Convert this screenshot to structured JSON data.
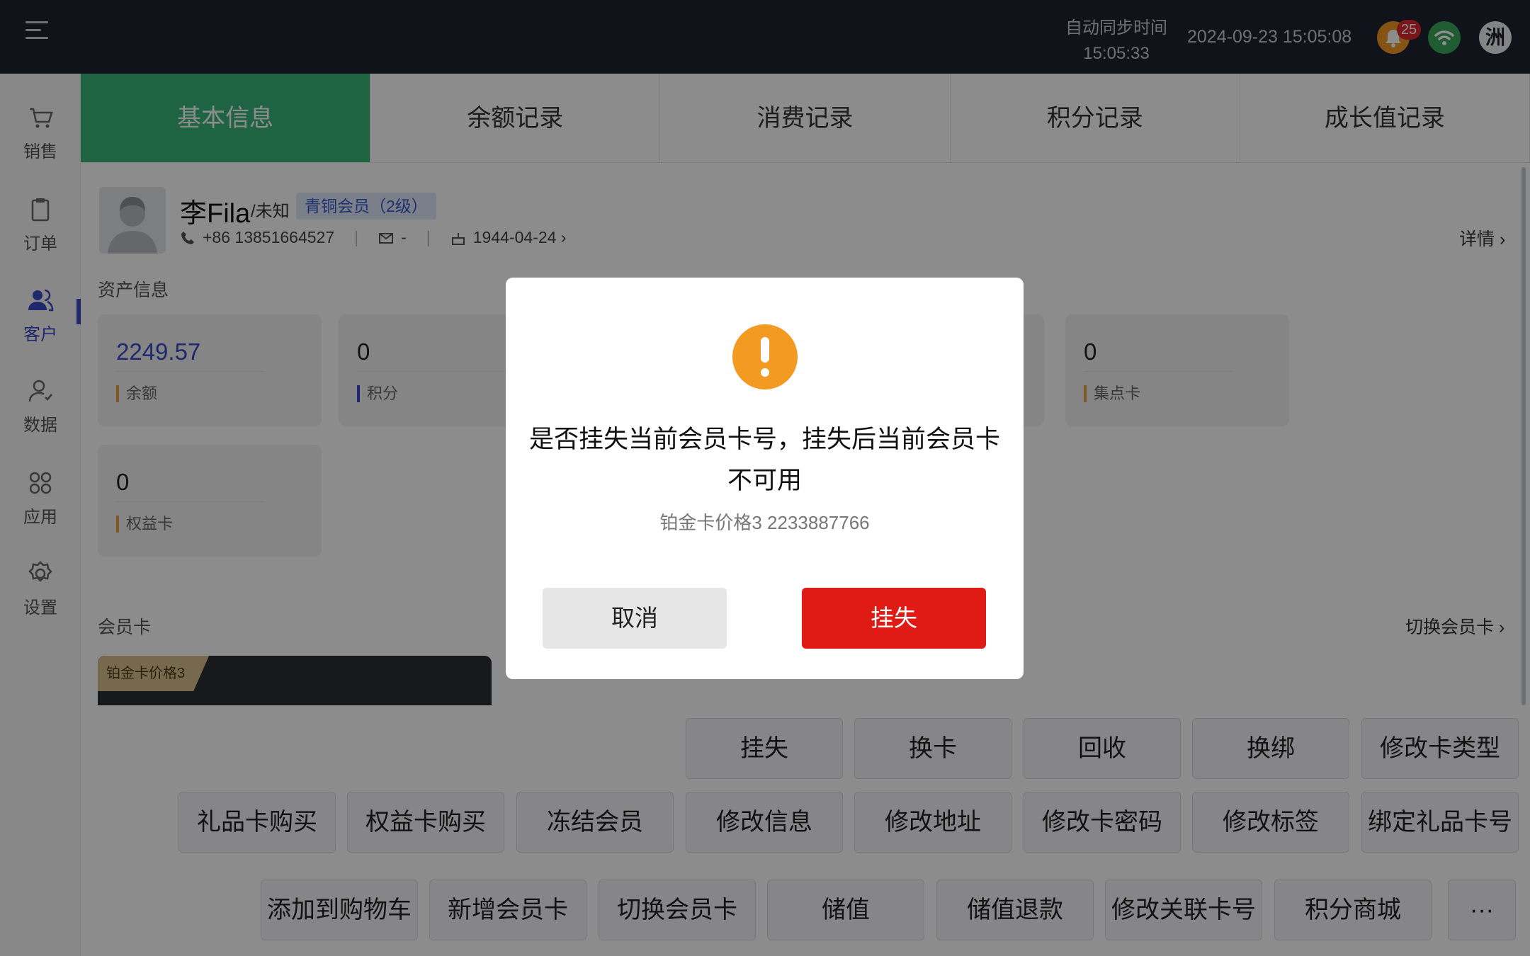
{
  "topbar": {
    "sync_label": "自动同步时间",
    "sync_time": "15:05:33",
    "datetime": "2024-09-23 15:05:08",
    "notification_count": "25",
    "avatar_char": "洲",
    "icons": [
      "menu-icon",
      "bell-icon",
      "wifi-icon",
      "avatar"
    ]
  },
  "sidebar": {
    "items": [
      {
        "label": "销售",
        "icon": "cart-icon"
      },
      {
        "label": "订单",
        "icon": "clipboard-icon"
      },
      {
        "label": "客户",
        "icon": "users-icon"
      },
      {
        "label": "数据",
        "icon": "user-data-icon"
      },
      {
        "label": "应用",
        "icon": "apps-grid-icon"
      },
      {
        "label": "设置",
        "icon": "gear-icon"
      }
    ],
    "active": "客户"
  },
  "tabs": [
    "基本信息",
    "余额记录",
    "消费记录",
    "积分记录",
    "成长值记录"
  ],
  "profile": {
    "name": "李Fila",
    "gender": "/未知",
    "level": "青铜会员（2级）",
    "phone": "+86 13851664527",
    "email": "-",
    "birthday": "1944-04-24 ›",
    "detail_link": "详情 ›"
  },
  "assets": {
    "title": "资产信息",
    "cards": [
      {
        "value": "2249.57",
        "label": "余额"
      },
      {
        "value": "0",
        "label": "积分"
      },
      {
        "value": "0",
        "label": "集点卡"
      },
      {
        "value": "0",
        "label": "权益卡"
      }
    ]
  },
  "member_card": {
    "title": "会员卡",
    "switch_link": "切换会员卡 ›",
    "card_name": "铂金卡价格3"
  },
  "actions": {
    "row1": [
      "挂失",
      "换卡",
      "回收",
      "换绑",
      "修改卡类型"
    ],
    "row2": [
      "礼品卡购买",
      "权益卡购买",
      "冻结会员",
      "修改信息",
      "修改地址",
      "修改卡密码",
      "修改标签",
      "绑定礼品卡号"
    ],
    "row3": [
      "添加到购物车",
      "新增会员卡",
      "切换会员卡",
      "储值",
      "储值退款",
      "修改关联卡号",
      "积分商城",
      "···"
    ]
  },
  "modal": {
    "title": "是否挂失当前会员卡号，挂失后当前会员卡不可用",
    "subtitle": "铂金卡价格3 2233887766",
    "cancel": "取消",
    "confirm": "挂失",
    "colors": {
      "warning": "#f29a21",
      "confirm": "#e01b15"
    }
  },
  "colors": {
    "accent": "#39b779",
    "primary": "#3a47c7",
    "topbar": "#1f2431"
  }
}
